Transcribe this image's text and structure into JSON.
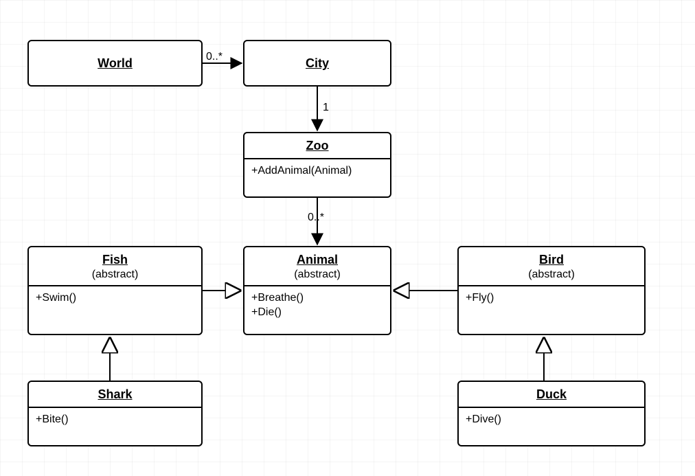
{
  "diagram": {
    "type": "uml-class-diagram",
    "classes": {
      "world": {
        "name": "World",
        "stereotype": "",
        "ops": []
      },
      "city": {
        "name": "City",
        "stereotype": "",
        "ops": []
      },
      "zoo": {
        "name": "Zoo",
        "stereotype": "",
        "ops": [
          "+AddAnimal(Animal)"
        ]
      },
      "animal": {
        "name": "Animal",
        "stereotype": "(abstract)",
        "ops": [
          "+Breathe()",
          "+Die()"
        ]
      },
      "fish": {
        "name": "Fish",
        "stereotype": "(abstract)",
        "ops": [
          "+Swim()"
        ]
      },
      "bird": {
        "name": "Bird",
        "stereotype": "(abstract)",
        "ops": [
          "+Fly()"
        ]
      },
      "shark": {
        "name": "Shark",
        "stereotype": "",
        "ops": [
          "+Bite()"
        ]
      },
      "duck": {
        "name": "Duck",
        "stereotype": "",
        "ops": [
          "+Dive()"
        ]
      }
    },
    "edges": [
      {
        "from": "world",
        "to": "city",
        "kind": "association",
        "label_to": "0..*"
      },
      {
        "from": "city",
        "to": "zoo",
        "kind": "association",
        "label_to": "1"
      },
      {
        "from": "zoo",
        "to": "animal",
        "kind": "association",
        "label_to": "0..*"
      },
      {
        "from": "fish",
        "to": "animal",
        "kind": "generalization"
      },
      {
        "from": "bird",
        "to": "animal",
        "kind": "generalization"
      },
      {
        "from": "shark",
        "to": "fish",
        "kind": "generalization"
      },
      {
        "from": "duck",
        "to": "bird",
        "kind": "generalization"
      }
    ],
    "multiplicity_labels": {
      "world_city": "0..*",
      "city_zoo": "1",
      "zoo_animal": "0..*"
    }
  }
}
